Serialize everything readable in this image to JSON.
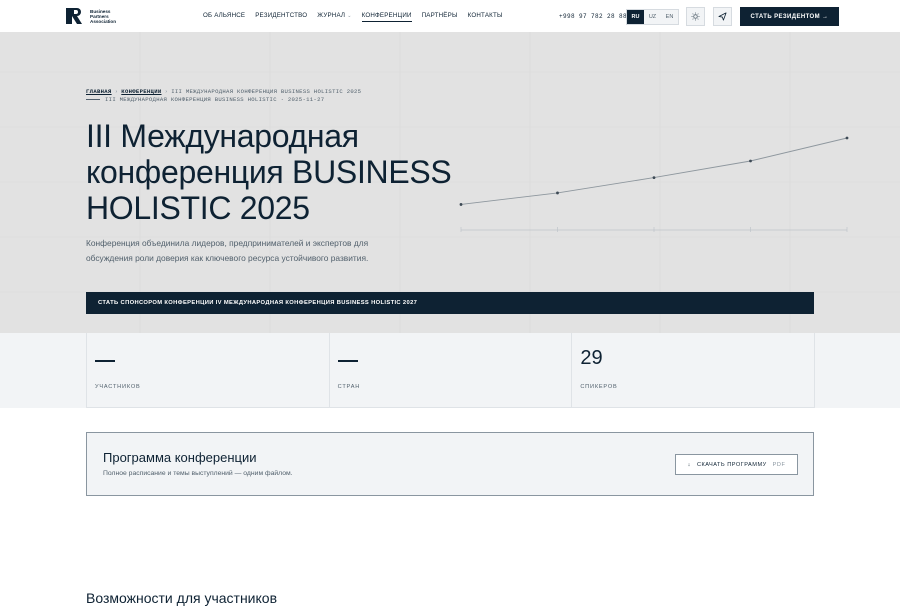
{
  "header": {
    "logo_text": "Business Partners Association",
    "nav": [
      {
        "label": "ОБ АЛЬЯНСЕ",
        "caret": false,
        "active": false
      },
      {
        "label": "РЕЗИДЕНТСТВО",
        "caret": false,
        "active": false
      },
      {
        "label": "ЖУРНАЛ",
        "caret": true,
        "active": false
      },
      {
        "label": "КОНФЕРЕНЦИИ",
        "caret": false,
        "active": true
      },
      {
        "label": "ПАРТНЁРЫ",
        "caret": false,
        "active": false
      },
      {
        "label": "КОНТАКТЫ",
        "caret": false,
        "active": false
      }
    ],
    "phone": "+998 97 782 28 88",
    "languages": [
      "RU",
      "UZ",
      "EN"
    ],
    "active_language": "RU",
    "theme_icon": "sun-icon",
    "telegram_icon": "send-icon",
    "cta_label": "СТАТЬ РЕЗИДЕНТОМ →"
  },
  "hero": {
    "breadcrumb": {
      "home": "ГЛАВНАЯ",
      "section": "КОНФЕРЕНЦИИ",
      "current": "III МЕЖДУНАРОДНАЯ КОНФЕРЕНЦИЯ BUSINESS HOLISTIC 2025",
      "separator": "›"
    },
    "meta": "III МЕЖДУНАРОДНАЯ КОНФЕРЕНЦИЯ BUSINESS HOLISTIC · 2025-11-27",
    "title": "III Международная конференция BUSINESS HOLISTIC 2025",
    "description": "Конференция объединила лидеров, предпринимателей и экспертов для обсуждения роли доверия как ключевого ресурса устойчивого развития.",
    "sponsor_label": "СТАТЬ СПОНСОРОМ КОНФЕРЕНЦИИ IV МЕЖДУНАРОДНАЯ КОНФЕРЕНЦИЯ BUSINESS HOLISTIC 2027"
  },
  "chart_data": {
    "type": "line",
    "x": [
      1,
      2,
      3,
      4,
      5
    ],
    "series": [
      {
        "values": [
          1.0,
          1.45,
          2.05,
          2.7,
          3.6
        ]
      }
    ],
    "title": "",
    "xlabel": "",
    "ylabel": "",
    "grid": false
  },
  "stats": [
    {
      "value": "—",
      "label": "УЧАСТНИКОВ"
    },
    {
      "value": "—",
      "label": "СТРАН"
    },
    {
      "value": "29",
      "label": "СПИКЕРОВ"
    }
  ],
  "program": {
    "title": "Программа конференции",
    "subtitle": "Полное расписание и темы выступлений — одним файлом.",
    "download_icon": "download-icon",
    "download_label": "СКАЧАТЬ ПРОГРАММУ",
    "download_format": "PDF"
  },
  "next_section": {
    "heading": "Возможности для участников"
  },
  "colors": {
    "navy": "#0e2233",
    "hero_bg": "#e2e2e2",
    "muted": "#51606c",
    "band_bg": "#f2f4f6"
  }
}
